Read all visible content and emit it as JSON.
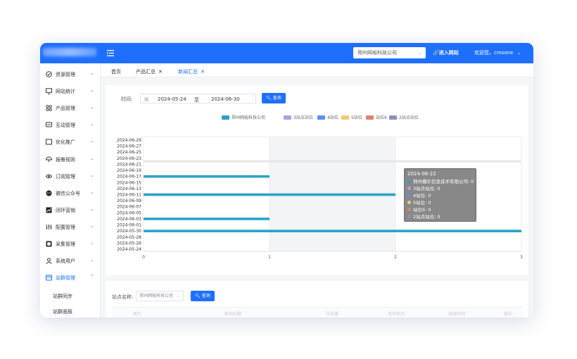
{
  "header": {
    "company_selected": "郑州网裕科技公司",
    "enter_site": "进入网站",
    "welcome": "欢迎您，cmsone"
  },
  "sidebar": {
    "items": [
      {
        "label": "资源管理",
        "icon": "folder-icon"
      },
      {
        "label": "网站统计",
        "icon": "monitor-icon"
      },
      {
        "label": "产品管理",
        "icon": "grid-icon"
      },
      {
        "label": "互动管理",
        "icon": "chat-icon"
      },
      {
        "label": "优化推广",
        "icon": "window-icon"
      },
      {
        "label": "报餐规则",
        "icon": "umbrella-icon"
      },
      {
        "label": "订阅管理",
        "icon": "eye-icon"
      },
      {
        "label": "微信公众号",
        "icon": "wechat-icon"
      },
      {
        "label": "闭环营销",
        "icon": "chart-icon"
      },
      {
        "label": "配置管理",
        "icon": "sliders-icon"
      },
      {
        "label": "采集管理",
        "icon": "collect-icon"
      },
      {
        "label": "系统用户",
        "icon": "user-icon"
      },
      {
        "label": "站群管理",
        "icon": "sites-icon"
      }
    ],
    "subitems": [
      "站群同步",
      "站群面板"
    ]
  },
  "tabs": [
    {
      "label": "首页"
    },
    {
      "label": "产品汇总"
    },
    {
      "label": "新闻汇总"
    }
  ],
  "filter": {
    "time_label": "时间:",
    "start_date": "2024-05-24",
    "separator": "至",
    "end_date": "2024-06-30",
    "query_label": "查询"
  },
  "legend": [
    {
      "name": "郑州网裕科技公司",
      "color": "#29a3c8"
    },
    {
      "name": "3站点站位",
      "color": "#b79de0"
    },
    {
      "name": "4站位",
      "color": "#5b8ff0"
    },
    {
      "name": "5站位",
      "color": "#f7c873"
    },
    {
      "name": "站位6",
      "color": "#e07f6f"
    },
    {
      "name": "2站点站位",
      "color": "#8a92b8"
    }
  ],
  "chart_data": {
    "type": "bar",
    "orientation": "horizontal",
    "categories": [
      "2024-05-24",
      "2024-05-26",
      "2024-05-28",
      "2024-05-30",
      "2024-06-01",
      "2024-06-03",
      "2024-06-05",
      "2024-06-07",
      "2024-06-09",
      "2024-06-11",
      "2024-06-13",
      "2024-06-15",
      "2024-06-17",
      "2024-06-19",
      "2024-06-21",
      "2024-06-23",
      "2024-06-25",
      "2024-06-27",
      "2024-06-29"
    ],
    "x_ticks": [
      "0",
      "1",
      "2",
      "3"
    ],
    "xlim": [
      0,
      3
    ],
    "grid": true,
    "bars": [
      {
        "date": "2024-06-17",
        "value": 1
      },
      {
        "date": "2024-06-11",
        "value": 2
      },
      {
        "date": "2024-06-03",
        "value": 1
      },
      {
        "date": "2024-05-30",
        "value": 3
      }
    ]
  },
  "tooltip": {
    "title": "2024-06-22",
    "rows": [
      {
        "text": "郑州播乐信息技术有限公司: 0",
        "color": "#29a3c8"
      },
      {
        "text": "3站点站位: 0",
        "color": "#b79de0"
      },
      {
        "text": "4站位: 0",
        "color": "#5b8ff0"
      },
      {
        "text": "5站位: 0",
        "color": "#f7c873"
      },
      {
        "text": "站位6: 0",
        "color": "#e07f6f"
      },
      {
        "text": "2站点站位: 0",
        "color": "#8a92b8"
      }
    ]
  },
  "site_filter": {
    "label": "站点名称:",
    "selected": "郑州网裕科技公司",
    "query_label": "查询"
  },
  "table": {
    "headers": [
      "图片",
      "新闻标题",
      "浏览量",
      "发布时间",
      "修改时间",
      "操作"
    ]
  },
  "colors": {
    "primary": "#1f6fff",
    "bar": "#29a3c8"
  }
}
